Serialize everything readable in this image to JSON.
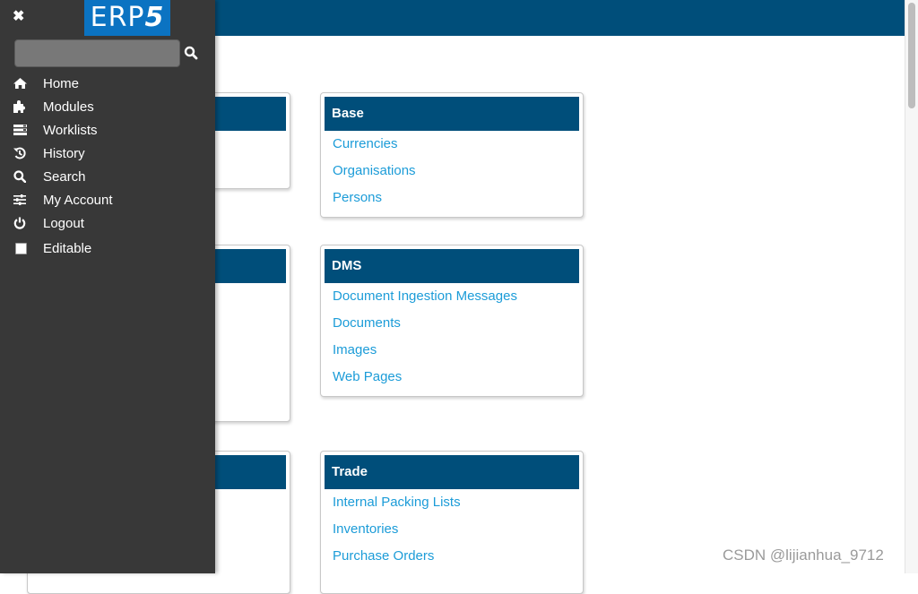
{
  "app": {
    "logo_text": "ERP",
    "logo_digit": "5",
    "brand_color": "#004e7a",
    "link_color": "#1c9cd8",
    "sidebar_color": "#383838"
  },
  "sidebar": {
    "close_icon": "close-icon",
    "search": {
      "value": "",
      "placeholder": ""
    },
    "items": [
      {
        "label": "Home",
        "icon": "home-icon"
      },
      {
        "label": "Modules",
        "icon": "puzzle-icon"
      },
      {
        "label": "Worklists",
        "icon": "tasks-icon"
      },
      {
        "label": "History",
        "icon": "history-icon"
      },
      {
        "label": "Search",
        "icon": "search-icon"
      },
      {
        "label": "My Account",
        "icon": "sliders-icon"
      },
      {
        "label": "Logout",
        "icon": "power-icon"
      },
      {
        "label": "Editable",
        "icon": "checkbox-icon",
        "checked": false
      }
    ]
  },
  "modules": [
    {
      "title": "",
      "links": []
    },
    {
      "title": "Base",
      "links": [
        "Currencies",
        "Organisations",
        "Persons"
      ]
    },
    {
      "title": "",
      "links": []
    },
    {
      "title": "DMS",
      "links": [
        "Document Ingestion Messages",
        "Documents",
        "Images",
        "Web Pages"
      ]
    },
    {
      "title": "",
      "links": []
    },
    {
      "title": "Trade",
      "links": [
        "Internal Packing Lists",
        "Inventories",
        "Purchase Orders"
      ]
    }
  ],
  "watermark": "CSDN @lijianhua_9712"
}
